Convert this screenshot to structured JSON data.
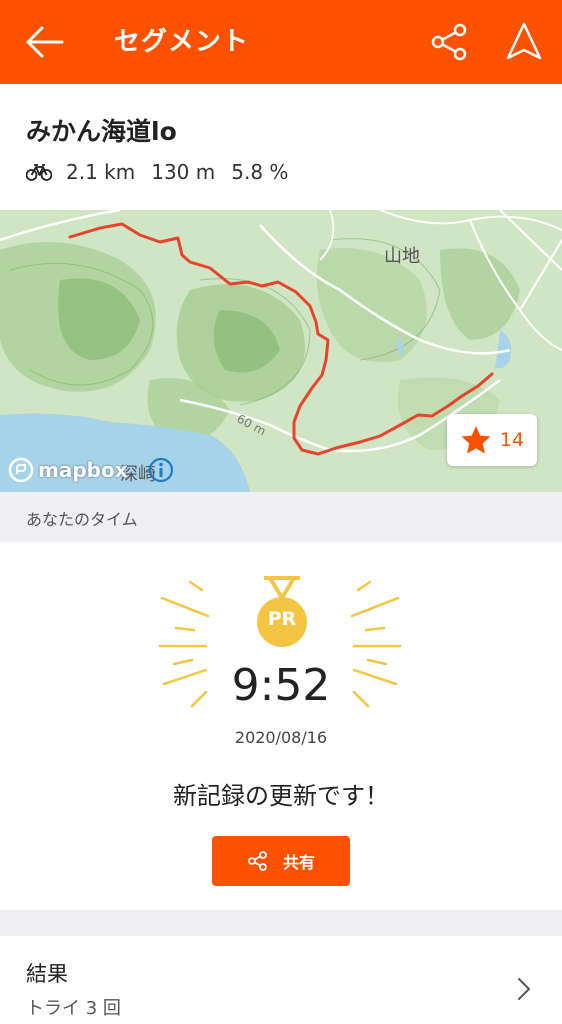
{
  "header": {
    "title": "セグメント",
    "accent": "#fc5200",
    "icons": [
      "back-arrow-icon",
      "share-icon",
      "navigate-icon"
    ]
  },
  "segment": {
    "name": "みかん海道lo",
    "activity_icon": "bicycle-icon",
    "distance": "2.1 km",
    "elevation": "130 m",
    "grade": "5.8 %"
  },
  "map": {
    "place_label": "山地",
    "place_label_2": "深崎",
    "road_label": "60 m",
    "attribution": "mapbox",
    "star_count": "14",
    "route_color": "#e8432d"
  },
  "your_time": {
    "section_label": "あなたのタイム",
    "badge": "PR",
    "time": "9:52",
    "date": "2020/08/16",
    "message": "新記録の更新です！",
    "share_label": "共有"
  },
  "results": {
    "title": "結果",
    "subtitle": "トライ 3 回"
  }
}
